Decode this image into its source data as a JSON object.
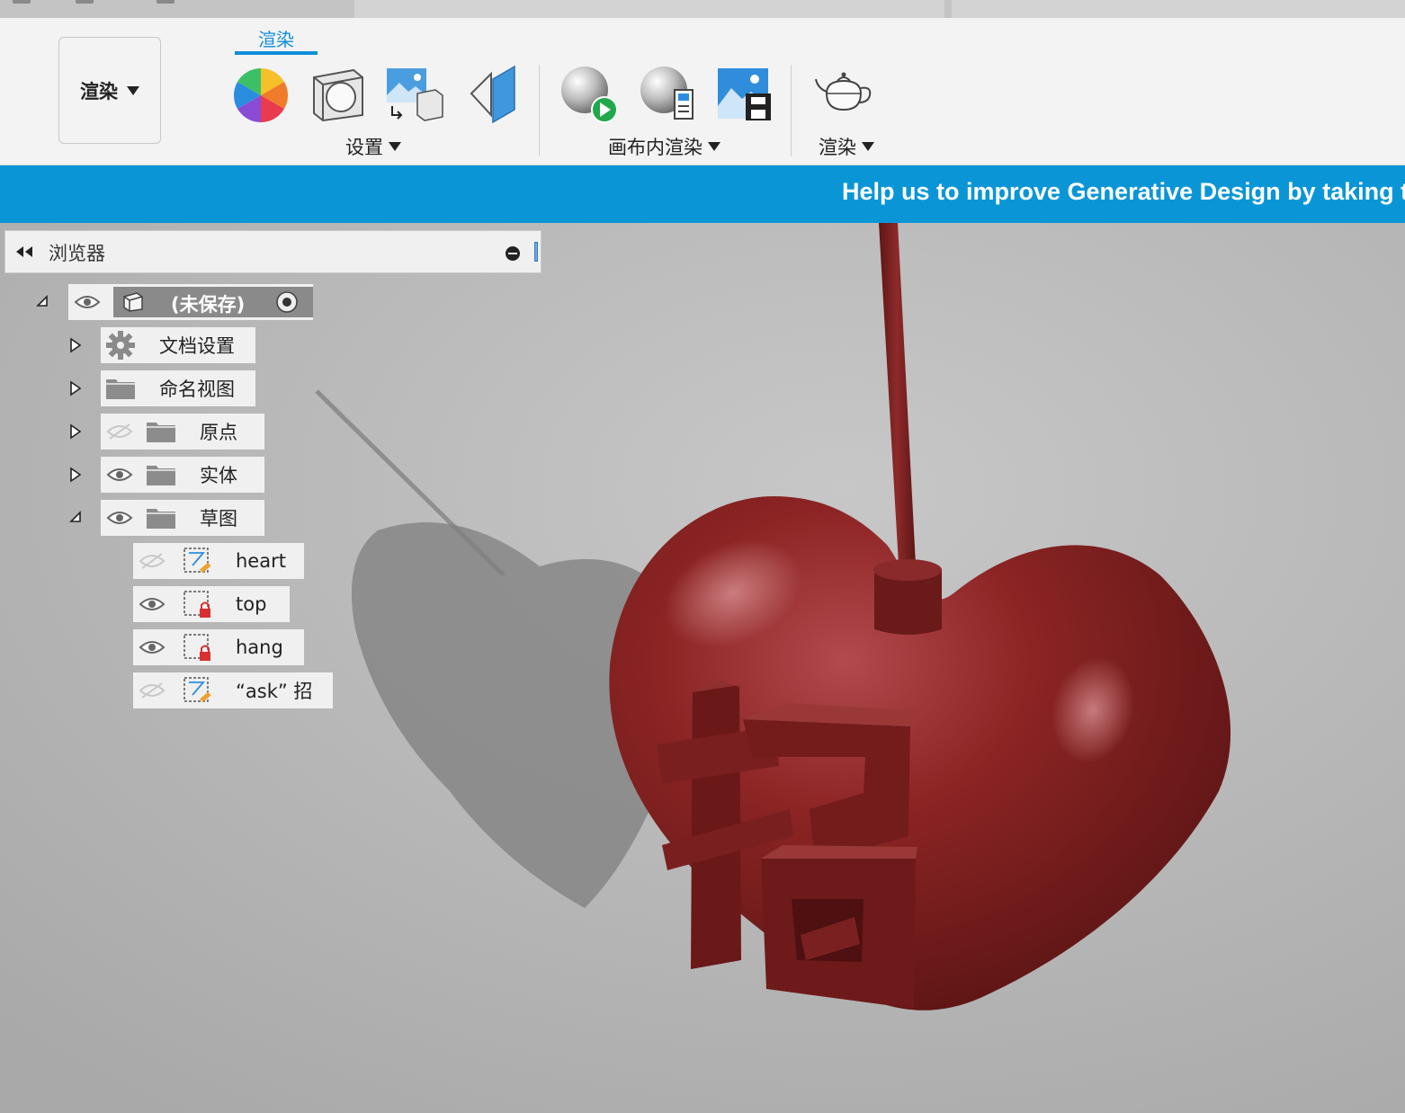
{
  "toolbar": {
    "workspace_label": "渲染",
    "active_tab": "渲染",
    "groups": {
      "setup": "设置",
      "in_canvas": "画布内渲染",
      "render": "渲染"
    }
  },
  "banner": {
    "text": "Help us to improve Generative Design by taking thi"
  },
  "browser": {
    "title": "浏览器",
    "root_label": "(未保存)",
    "items": [
      {
        "label": "文档设置",
        "icon": "gear-icon"
      },
      {
        "label": "命名视图",
        "icon": "folder-icon"
      },
      {
        "label": "原点",
        "icon": "folder-icon",
        "visible": false
      },
      {
        "label": "实体",
        "icon": "folder-icon",
        "visible": true
      },
      {
        "label": "草图",
        "icon": "folder-icon",
        "visible": true,
        "expanded": true
      }
    ],
    "sketches": [
      {
        "label": "heart",
        "visible": false,
        "locked": false
      },
      {
        "label": "top",
        "visible": true,
        "locked": true
      },
      {
        "label": "hang",
        "visible": true,
        "locked": true
      },
      {
        "label": "“ask” 招",
        "visible": false,
        "locked": false
      }
    ]
  },
  "model": {
    "character": "招"
  },
  "colors": {
    "accent": "#0d8ed8",
    "banner": "#0a96d6",
    "heart": "#8b2020",
    "viewport": "#b5b5b5"
  }
}
